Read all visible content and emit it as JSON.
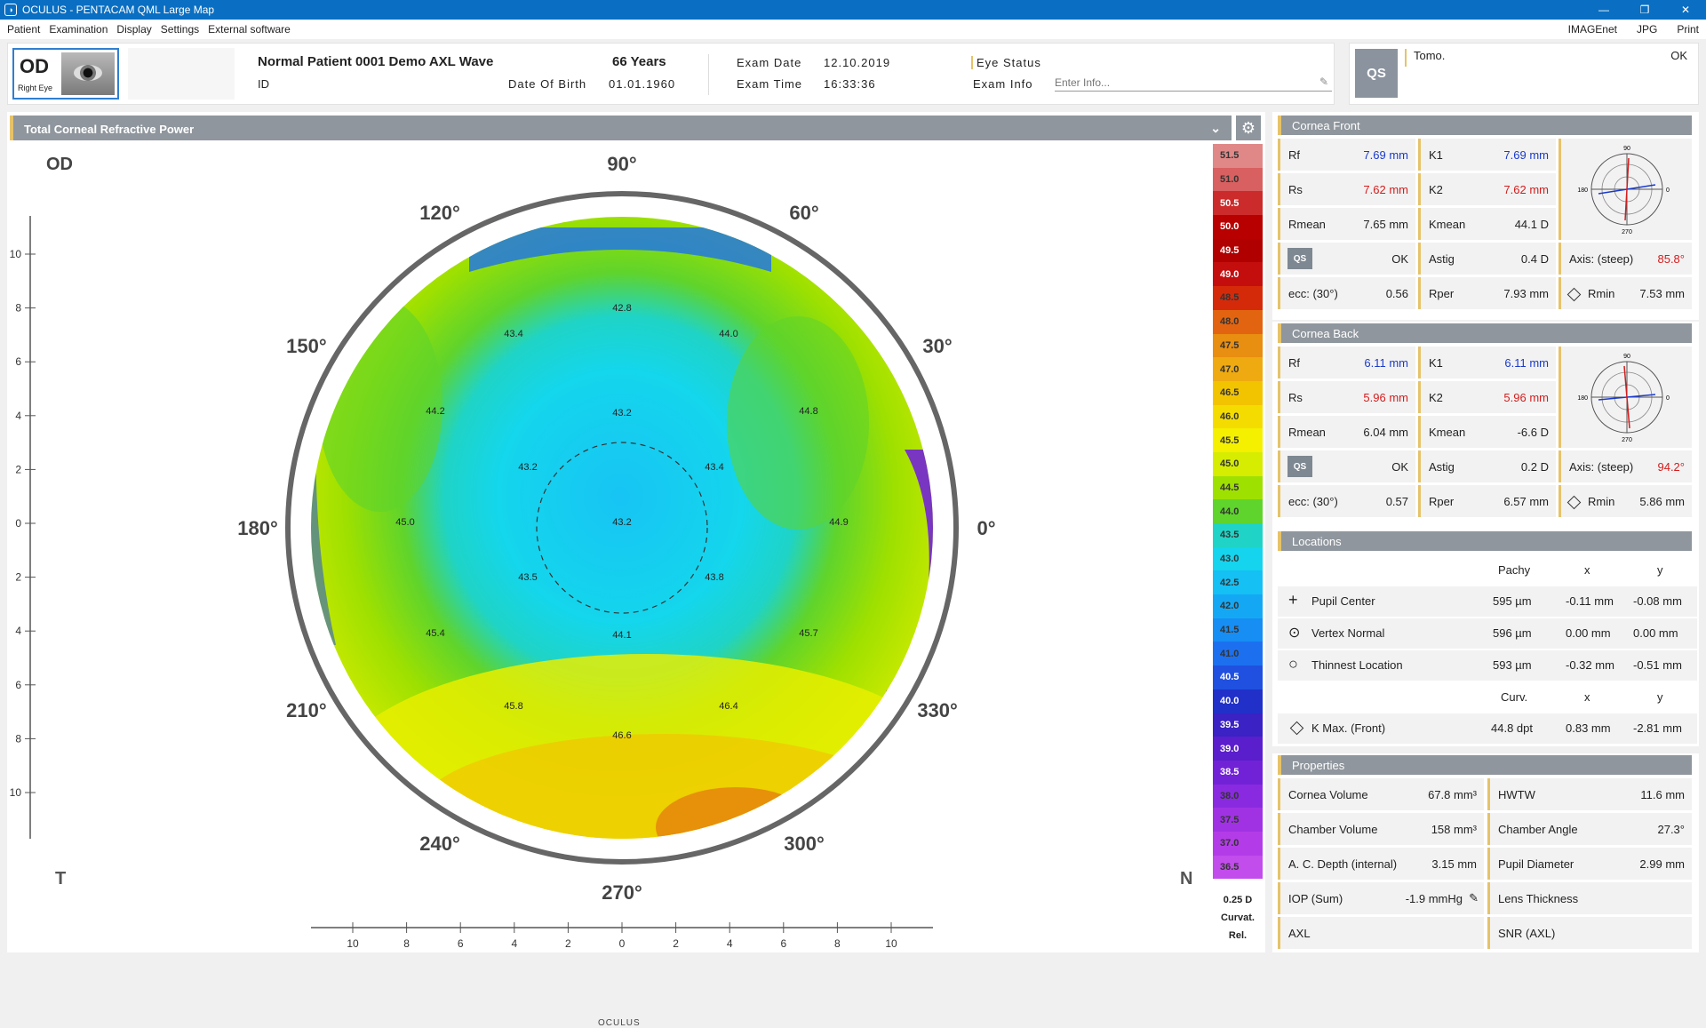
{
  "window": {
    "title": "OCULUS - PENTACAM   QML Large Map",
    "controls": [
      "—",
      "❐",
      "✕"
    ]
  },
  "menu": {
    "items": [
      "Patient",
      "Examination",
      "Display",
      "Settings",
      "External software"
    ],
    "right": [
      "IMAGEnet",
      "JPG",
      "Print"
    ]
  },
  "patient": {
    "eye": "OD",
    "eye_label": "Right Eye",
    "name": "Normal Patient 0001 Demo AXL Wave",
    "id_label": "ID",
    "age": "66 Years",
    "dob_label": "Date Of Birth",
    "dob": "01.01.1960"
  },
  "exam": {
    "date_label": "Exam Date",
    "date": "12.10.2019",
    "time_label": "Exam Time",
    "time": "16:33:36",
    "status_label": "Eye Status",
    "info_label": "Exam Info",
    "info_placeholder": "Enter Info..."
  },
  "qs": {
    "button": "QS",
    "tomo_label": "Tomo.",
    "tomo_value": "OK"
  },
  "map": {
    "title": "Total Corneal Refractive Power",
    "eye": "OD",
    "left_side": "T",
    "right_side": "N",
    "angle_labels": [
      "90°",
      "60°",
      "30°",
      "0°",
      "330°",
      "300°",
      "270°",
      "240°",
      "210°",
      "180°",
      "150°",
      "120°"
    ],
    "values": [
      "42.8",
      "43.4",
      "44.0",
      "44.2",
      "43.2",
      "44.8",
      "43.2",
      "43.4",
      "45.0",
      "43.2",
      "44.9",
      "43.5",
      "43.8",
      "45.4",
      "44.1",
      "45.7",
      "45.8",
      "46.4",
      "46.6"
    ],
    "left_ticks": [
      "10",
      "8",
      "6",
      "4",
      "2",
      "0",
      "2",
      "4",
      "6",
      "8",
      "10"
    ],
    "bottom_ticks": [
      "10",
      "8",
      "6",
      "4",
      "2",
      "0",
      "2",
      "4",
      "6",
      "8",
      "10"
    ],
    "logo": "OCULUS"
  },
  "color_scale": {
    "values": [
      "51.5",
      "51.0",
      "50.5",
      "50.0",
      "49.5",
      "49.0",
      "48.5",
      "48.0",
      "47.5",
      "47.0",
      "46.5",
      "46.0",
      "45.5",
      "45.0",
      "44.5",
      "44.0",
      "43.5",
      "43.0",
      "42.5",
      "42.0",
      "41.5",
      "41.0",
      "40.5",
      "40.0",
      "39.5",
      "39.0",
      "38.5",
      "38.0",
      "37.5",
      "37.0",
      "36.5"
    ],
    "colors": [
      "#e08888",
      "#d86060",
      "#cc2b2b",
      "#b80000",
      "#b00000",
      "#c40e0e",
      "#d52a0a",
      "#e26410",
      "#e88e10",
      "#eeaa10",
      "#f2c400",
      "#f4dc00",
      "#f4f000",
      "#d6ec00",
      "#9ee000",
      "#5fd42c",
      "#1fd4c6",
      "#14d4ee",
      "#14c0f4",
      "#14a8f4",
      "#168ef4",
      "#1c70f0",
      "#2050e0",
      "#2030c8",
      "#3a22c4",
      "#5a1ecc",
      "#7222d6",
      "#8a2ae0",
      "#a032e4",
      "#b43ce8",
      "#c24cec"
    ],
    "step": "0.25 D",
    "mode1": "Curvat.",
    "mode2": "Rel."
  },
  "cornea_front": {
    "title": "Cornea Front",
    "rf_label": "Rf",
    "rf": "7.69 mm",
    "k1_label": "K1",
    "k1": "7.69 mm",
    "rs_label": "Rs",
    "rs": "7.62 mm",
    "k2_label": "K2",
    "k2": "7.62 mm",
    "rmean_label": "Rmean",
    "rmean": "7.65 mm",
    "kmean_label": "Kmean",
    "kmean": "44.1 D",
    "qs_label": "QS",
    "qs": "OK",
    "astig_label": "Astig",
    "astig": "0.4 D",
    "axis_label": "Axis: (steep)",
    "axis": "85.8°",
    "ecc_label": "ecc: (30°)",
    "ecc": "0.56",
    "rper_label": "Rper",
    "rper": "7.93 mm",
    "rmin_label": "Rmin",
    "rmin": "7.53 mm",
    "dial": [
      "90",
      "180",
      "0",
      "270"
    ]
  },
  "cornea_back": {
    "title": "Cornea Back",
    "rf_label": "Rf",
    "rf": "6.11 mm",
    "k1_label": "K1",
    "k1": "6.11 mm",
    "rs_label": "Rs",
    "rs": "5.96 mm",
    "k2_label": "K2",
    "k2": "5.96 mm",
    "rmean_label": "Rmean",
    "rmean": "6.04 mm",
    "kmean_label": "Kmean",
    "kmean": "-6.6 D",
    "qs_label": "QS",
    "qs": "OK",
    "astig_label": "Astig",
    "astig": "0.2 D",
    "axis_label": "Axis: (steep)",
    "axis": "94.2°",
    "ecc_label": "ecc: (30°)",
    "ecc": "0.57",
    "rper_label": "Rper",
    "rper": "6.57 mm",
    "rmin_label": "Rmin",
    "rmin": "5.86 mm",
    "dial": [
      "90",
      "180",
      "0",
      "270"
    ]
  },
  "locations": {
    "title": "Locations",
    "headers": [
      "Pachy",
      "x",
      "y"
    ],
    "rows": [
      {
        "icon": "+",
        "label": "Pupil Center",
        "pachy": "595 µm",
        "x": "-0.11 mm",
        "y": "-0.08 mm"
      },
      {
        "icon": "⊙",
        "label": "Vertex Normal",
        "pachy": "596 µm",
        "x": "0.00 mm",
        "y": "0.00 mm"
      },
      {
        "icon": "○",
        "label": "Thinnest Location",
        "pachy": "593 µm",
        "x": "-0.32 mm",
        "y": "-0.51 mm"
      }
    ],
    "headers2": [
      "Curv.",
      "x",
      "y"
    ],
    "kmax": {
      "label": "K Max. (Front)",
      "curv": "44.8 dpt",
      "x": "0.83 mm",
      "y": "-2.81 mm"
    }
  },
  "properties": {
    "title": "Properties",
    "rows": [
      {
        "l1": "Cornea Volume",
        "v1": "67.8 mm³",
        "l2": "HWTW",
        "v2": "11.6 mm"
      },
      {
        "l1": "Chamber Volume",
        "v1": "158 mm³",
        "l2": "Chamber Angle",
        "v2": "27.3°"
      },
      {
        "l1": "A. C. Depth (internal)",
        "v1": "3.15 mm",
        "l2": "Pupil Diameter",
        "v2": "2.99 mm"
      },
      {
        "l1": "IOP (Sum)",
        "v1": "-1.9 mmHg",
        "l2": "Lens Thickness",
        "v2": ""
      },
      {
        "l1": "AXL",
        "v1": "",
        "l2": "SNR (AXL)",
        "v2": ""
      }
    ]
  }
}
